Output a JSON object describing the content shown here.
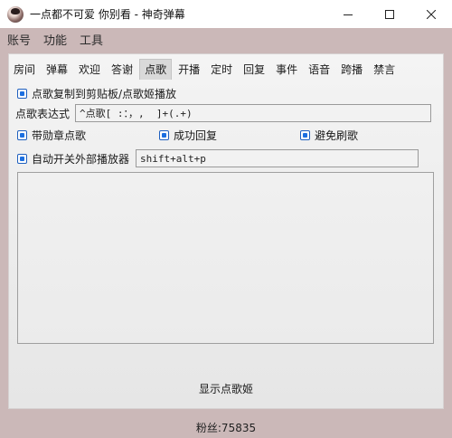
{
  "window": {
    "title": "一点都不可爱 你别看 - 神奇弹幕"
  },
  "menu": {
    "items": [
      "账号",
      "功能",
      "工具"
    ]
  },
  "tabs": [
    {
      "label": "房间",
      "active": false
    },
    {
      "label": "弹幕",
      "active": false
    },
    {
      "label": "欢迎",
      "active": false
    },
    {
      "label": "答谢",
      "active": false
    },
    {
      "label": "点歌",
      "active": true
    },
    {
      "label": "开播",
      "active": false
    },
    {
      "label": "定时",
      "active": false
    },
    {
      "label": "回复",
      "active": false
    },
    {
      "label": "事件",
      "active": false
    },
    {
      "label": "语音",
      "active": false
    },
    {
      "label": "跨播",
      "active": false
    },
    {
      "label": "禁言",
      "active": false
    }
  ],
  "song_request": {
    "copy_to_clipboard": {
      "label": "点歌复制到剪贴板/点歌姬播放",
      "checked": true
    },
    "expression": {
      "label": "点歌表达式",
      "value": "^点歌[ :：，,  ]+(.+)"
    },
    "with_medal": {
      "label": "带勋章点歌",
      "checked": true
    },
    "success_reply": {
      "label": "成功回复",
      "checked": true
    },
    "avoid_spam": {
      "label": "避免刷歌",
      "checked": true
    },
    "auto_player": {
      "label": "自动开关外部播放器",
      "checked": true
    },
    "hotkey": {
      "value": "shift+alt+p"
    },
    "song_list": {
      "value": ""
    },
    "show_button": "显示点歌姬"
  },
  "status": {
    "fans": "粉丝:75835"
  },
  "colors": {
    "window_bg": "#cbb8b8",
    "panel_bg": "#eeeeee",
    "checkbox_accent": "#1c6fe0"
  }
}
